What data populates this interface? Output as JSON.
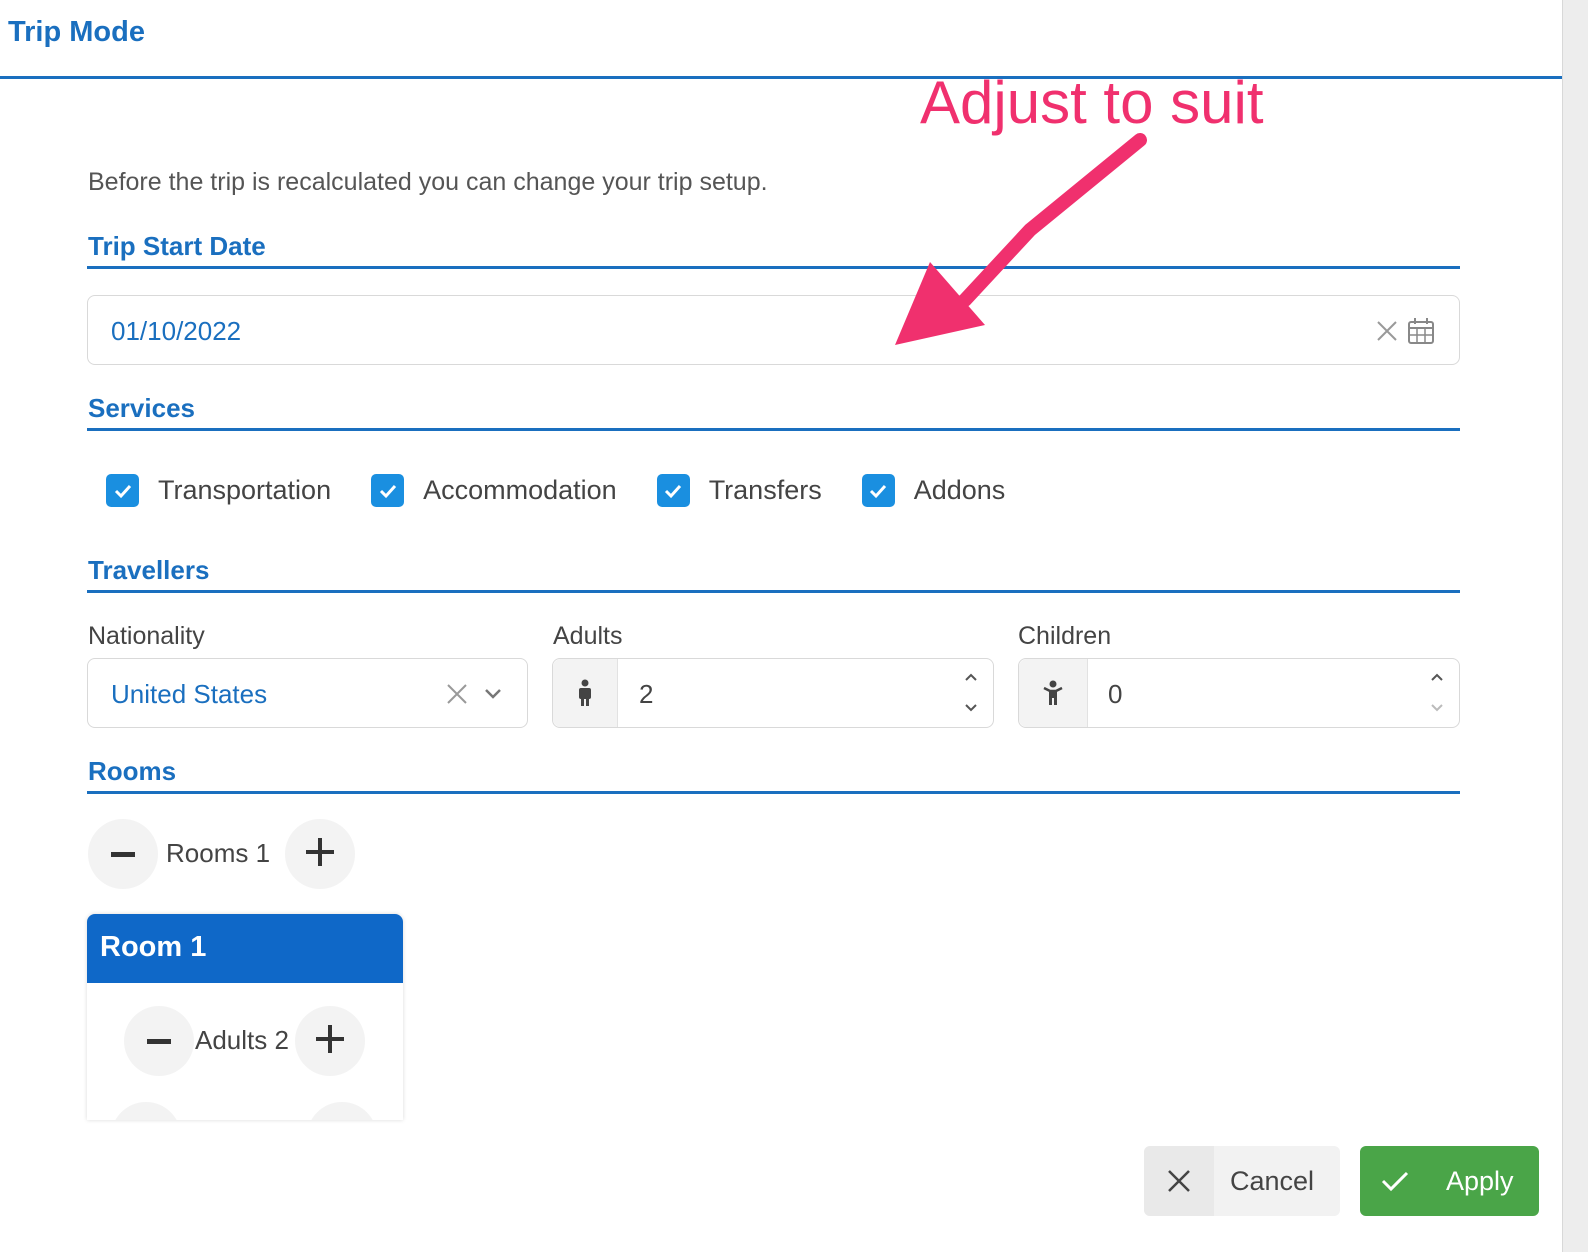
{
  "dialog": {
    "title": "Trip Mode",
    "intro": "Before the trip is recalculated you can change your trip setup."
  },
  "trip_start": {
    "section_title": "Trip Start Date",
    "date_value": "01/10/2022"
  },
  "services": {
    "section_title": "Services",
    "items": [
      {
        "label": "Transportation",
        "checked": true
      },
      {
        "label": "Accommodation",
        "checked": true
      },
      {
        "label": "Transfers",
        "checked": true
      },
      {
        "label": "Addons",
        "checked": true
      }
    ]
  },
  "travellers": {
    "section_title": "Travellers",
    "nationality_label": "Nationality",
    "nationality_value": "United States",
    "adults_label": "Adults",
    "adults_value": "2",
    "children_label": "Children",
    "children_value": "0"
  },
  "rooms": {
    "section_title": "Rooms",
    "rooms_counter": "Rooms 1",
    "room_card_title": "Room 1",
    "room_adults_counter": "Adults 2"
  },
  "footer": {
    "cancel_label": "Cancel",
    "apply_label": "Apply"
  },
  "annotation": {
    "text": "Adjust to suit"
  },
  "colors": {
    "accent": "#1a6fbf",
    "checkbox": "#1a8fe0",
    "room_header": "#0f68c8",
    "apply": "#4aa548",
    "annotation": "#f0306e"
  },
  "icons": [
    "clear-x-icon",
    "calendar-icon",
    "chevron-down-icon",
    "adult-person-icon",
    "child-person-icon",
    "chevron-up-icon",
    "minus-icon",
    "plus-icon",
    "check-icon",
    "close-icon"
  ]
}
